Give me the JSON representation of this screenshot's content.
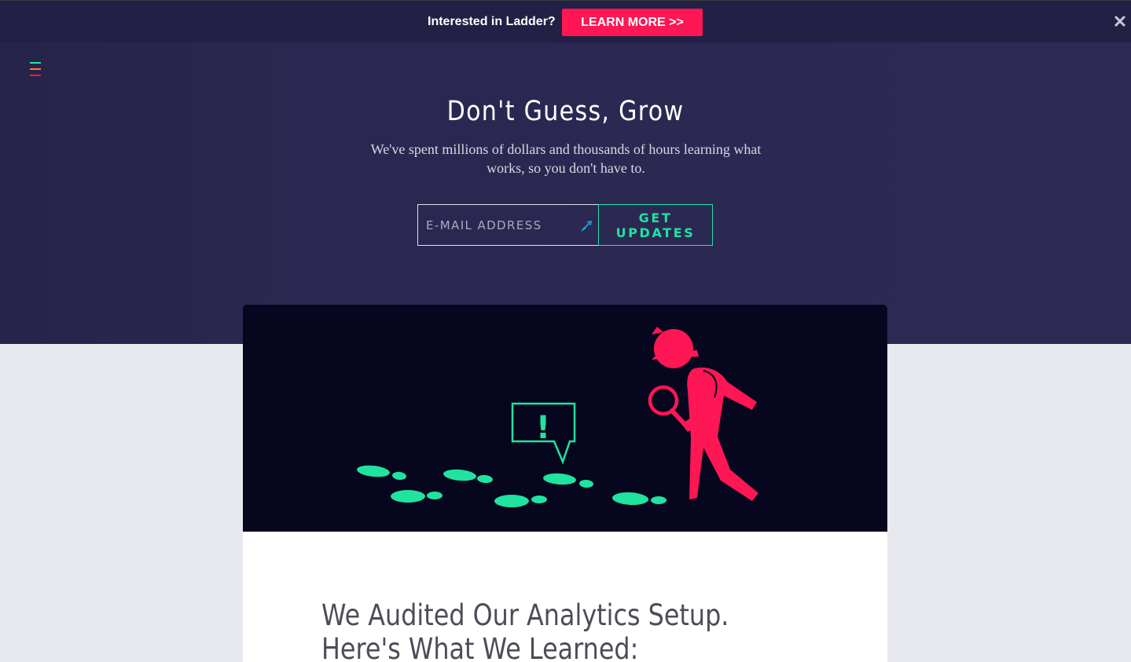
{
  "promo": {
    "text": "Interested in Ladder?",
    "button_label": "LEARN MORE >>",
    "close_glyph": "✕"
  },
  "hero": {
    "title": "Don't Guess, Grow",
    "subtitle": "We've spent millions of dollars and thousands of hours learning what works, so you don't have to.",
    "email_placeholder": "E-MAIL ADDRESS",
    "submit_label": "GET UPDATES"
  },
  "article": {
    "title": "We Audited Our Analytics Setup. Here's What We Learned:"
  },
  "icons": {
    "menu": "menu-icon",
    "close": "close-icon",
    "email_field": "pencil-icon",
    "speech_bubble_glyph": "!"
  },
  "colors": {
    "accent_green": "#20e3a0",
    "accent_pink": "#ff1654",
    "accent_orange": "#ff7a2b",
    "hero_bg": "#2a2850",
    "page_bg": "#e8e9ef",
    "illustration_bg": "#06061e"
  }
}
